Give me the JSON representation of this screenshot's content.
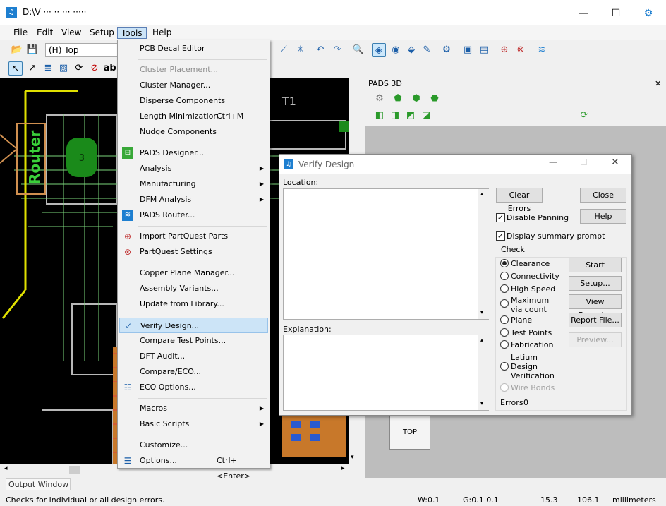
{
  "window": {
    "title": "D:\\V ··· ·· ··· ·····",
    "minimize": "—",
    "maximize": "☐",
    "close": "✕"
  },
  "menubar": [
    "File",
    "Edit",
    "View",
    "Setup",
    "Tools",
    "Help"
  ],
  "toolbar": {
    "layer": "(H) Top",
    "text_tool": "ab|"
  },
  "pcb": {
    "router_label": "Router",
    "ref_t1": "T1",
    "ref_3": "3"
  },
  "pads3d": {
    "title": "PADS 3D",
    "close": "✕",
    "top_label": "TOP"
  },
  "tools_menu": [
    {
      "label": "PCB Decal Editor"
    },
    {
      "label": "Cluster Placement...",
      "disabled": true
    },
    {
      "label": "Cluster Manager..."
    },
    {
      "label": "Disperse Components"
    },
    {
      "label": "Length Minimization",
      "shortcut": "Ctrl+M"
    },
    {
      "label": "Nudge Components"
    },
    {
      "label": "PADS Designer..."
    },
    {
      "label": "Analysis",
      "submenu": true
    },
    {
      "label": "Manufacturing",
      "submenu": true
    },
    {
      "label": "DFM Analysis",
      "submenu": true
    },
    {
      "label": "PADS Router..."
    },
    {
      "label": "Import PartQuest Parts"
    },
    {
      "label": "PartQuest Settings"
    },
    {
      "label": "Copper Plane Manager..."
    },
    {
      "label": "Assembly Variants..."
    },
    {
      "label": "Update from Library..."
    },
    {
      "label": "Verify Design...",
      "checked": true,
      "highlighted": true
    },
    {
      "label": "Compare Test Points..."
    },
    {
      "label": "DFT Audit..."
    },
    {
      "label": "Compare/ECO..."
    },
    {
      "label": "ECO Options..."
    },
    {
      "label": "Macros",
      "submenu": true
    },
    {
      "label": "Basic Scripts",
      "submenu": true
    },
    {
      "label": "Customize..."
    },
    {
      "label": "Options...",
      "shortcut": "Ctrl+<Enter>"
    }
  ],
  "dialog": {
    "title": "Verify Design",
    "location_label": "Location:",
    "explanation_label": "Explanation:",
    "clear_errors": "Clear Errors",
    "close": "Close",
    "help": "Help",
    "disable_panning": "Disable Panning",
    "disable_panning_checked": true,
    "display_summary": "Display summary prompt",
    "display_summary_checked": true,
    "check_label": "Check",
    "checks": [
      {
        "label": "Clearance",
        "selected": true
      },
      {
        "label": "Connectivity"
      },
      {
        "label": "High Speed"
      },
      {
        "label": "Maximum via count"
      },
      {
        "label": "Plane"
      },
      {
        "label": "Test Points"
      },
      {
        "label": "Fabrication"
      },
      {
        "label": "Latium Design Verification"
      },
      {
        "label": "Wire Bonds",
        "disabled": true
      }
    ],
    "start": "Start",
    "setup": "Setup...",
    "view_report": "View Report...",
    "report_file": "Report File...",
    "preview": "Preview...",
    "errors_label": "Errors",
    "errors_value": "0"
  },
  "output_tab": "Output Window",
  "status": {
    "message": "Checks for individual or all design errors.",
    "w": "W:0.1",
    "g": "G:0.1 0.1",
    "x": "15.3",
    "y": "106.1",
    "units": "millimeters"
  },
  "colors": {
    "accent": "#1e7fd0",
    "selection": "#cce4f7",
    "pcb_bg": "#000000",
    "trace_yellow": "#e0e000",
    "outline_gray": "#c0c0c0"
  }
}
